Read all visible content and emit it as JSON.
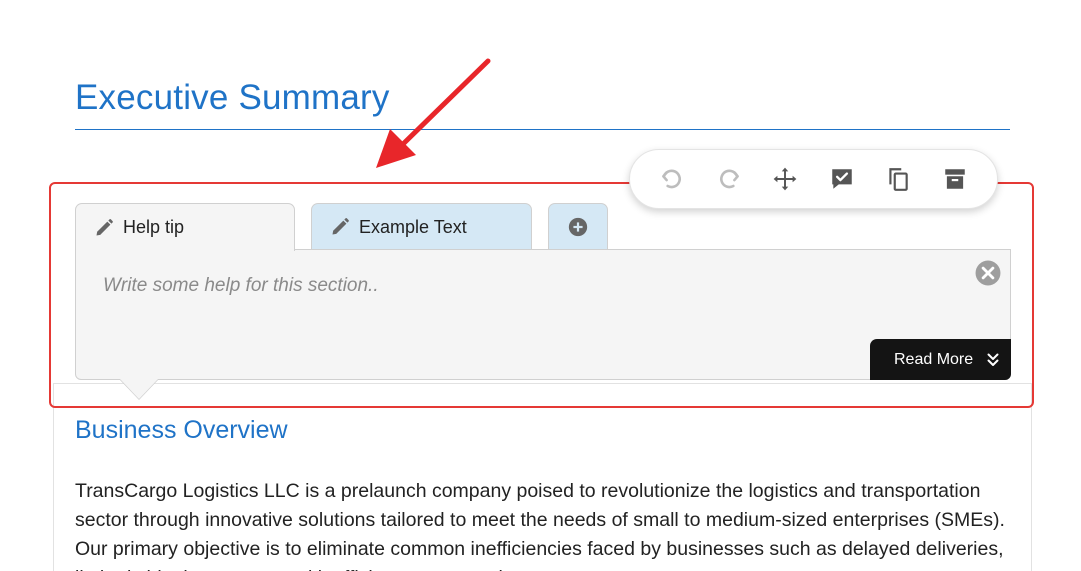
{
  "page": {
    "title": "Executive Summary"
  },
  "toolbar": {
    "buttons": [
      {
        "name": "undo-icon"
      },
      {
        "name": "redo-icon"
      },
      {
        "name": "move-icon"
      },
      {
        "name": "comment-check-icon"
      },
      {
        "name": "copy-icon"
      },
      {
        "name": "archive-icon"
      }
    ]
  },
  "tabs": {
    "help_tip": "Help tip",
    "example_text": "Example Text",
    "add_icon": "plus-circle-icon"
  },
  "editor": {
    "placeholder": "Write some help for this section..",
    "read_more": "Read More"
  },
  "section": {
    "heading": "Business Overview",
    "body": "TransCargo Logistics LLC is a prelaunch company poised to revolutionize the logistics and transportation sector through innovative solutions tailored to meet the needs of small to medium-sized enterprises (SMEs). Our primary objective is to eliminate common inefficiencies faced by businesses such as delayed deliveries, limited shipping routes, and inefficient transportation"
  },
  "colors": {
    "accent": "#1f73c7",
    "highlight": "#e53935",
    "tab_inactive": "#d5e8f5",
    "read_more_bg": "#141414"
  }
}
